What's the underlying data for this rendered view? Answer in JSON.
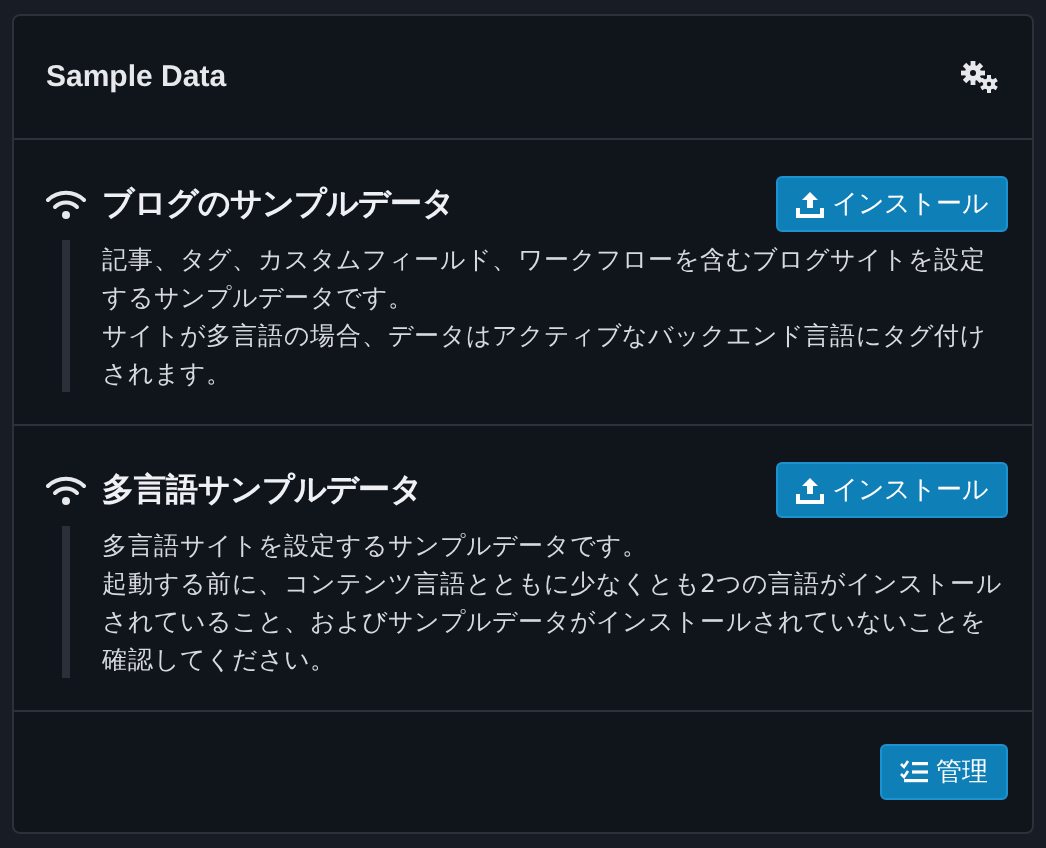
{
  "panel": {
    "title": "Sample Data"
  },
  "items": [
    {
      "title": "ブログのサンプルデータ",
      "button": "インストール",
      "paragraphs": [
        "記事、タグ、カスタムフィールド、ワークフローを含むブログサイトを設定するサンプルデータです。",
        "サイトが多言語の場合、データはアクティブなバックエンド言語にタグ付けされます。"
      ]
    },
    {
      "title": "多言語サンプルデータ",
      "button": "インストール",
      "paragraphs": [
        "多言語サイトを設定するサンプルデータです。",
        "起動する前に、コンテンツ言語とともに少なくとも2つの言語がインストールされていること、およびサンプルデータがインストールされていないことを確認してください。"
      ]
    }
  ],
  "footer": {
    "button": "管理"
  }
}
